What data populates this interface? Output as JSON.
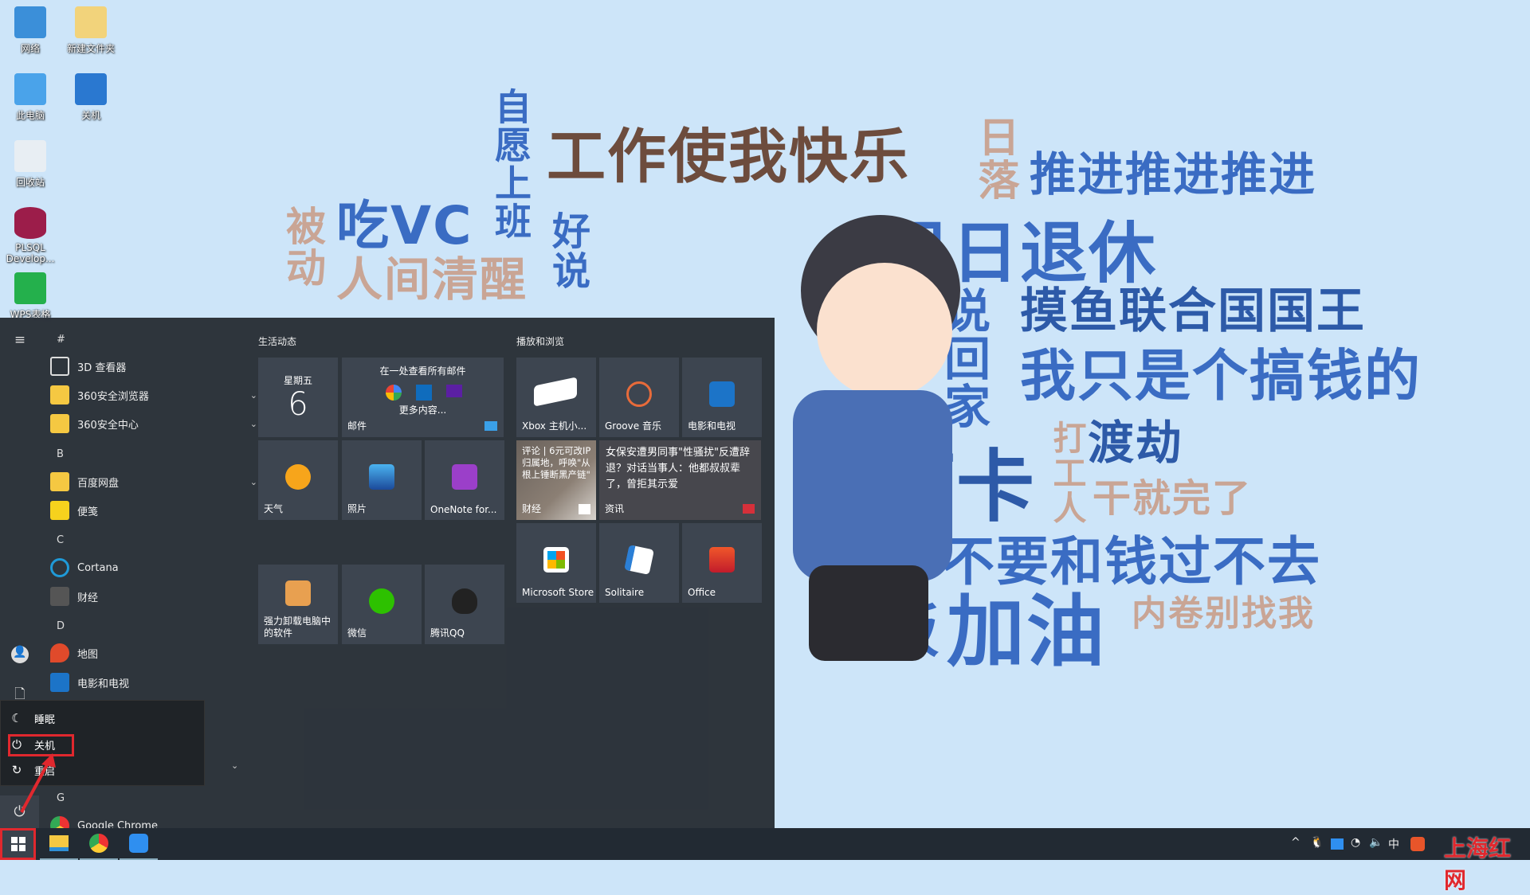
{
  "desktop": {
    "icons": [
      {
        "label": "网络",
        "color": "#3b8fd9"
      },
      {
        "label": "新建文件夹",
        "color": "#f2d37b"
      },
      {
        "label": "此电脑",
        "color": "#4aa3ea"
      },
      {
        "label": "关机",
        "color": "#2a78d0"
      },
      {
        "label": "回收站",
        "color": "#e8eef3"
      },
      {
        "label": "PLSQL Develop...",
        "color": "#9c1d4a"
      },
      {
        "label": "WPS表格",
        "color": "#24b04c"
      }
    ]
  },
  "wallpaper": {
    "words": [
      "工作使我快乐",
      "推进推进推进",
      "自愿上班",
      "日落",
      "吃VC",
      "人间清醒",
      "好说",
      "被动",
      "早日退休",
      "摸鱼联合国国王",
      "我只是个搞钱的",
      "说回家",
      "打卡",
      "渡劫",
      "打工人",
      "干就完了",
      "不要和钱过不去",
      "干饭",
      "加油",
      "内卷别找我"
    ]
  },
  "start_menu": {
    "letters": [
      "#",
      "B",
      "C",
      "D",
      "G"
    ],
    "apps": [
      {
        "label": "3D 查看器",
        "icon": "cube-icon",
        "expandable": false
      },
      {
        "label": "360安全浏览器",
        "icon": "folder-icon",
        "expandable": true
      },
      {
        "label": "360安全中心",
        "icon": "folder-icon",
        "expandable": true
      },
      {
        "label": "百度网盘",
        "icon": "folder-icon",
        "expandable": true
      },
      {
        "label": "便笺",
        "icon": "sticky-notes-icon",
        "expandable": false
      },
      {
        "label": "Cortana",
        "icon": "cortana-icon",
        "expandable": false
      },
      {
        "label": "财经",
        "icon": "finance-icon",
        "expandable": false
      },
      {
        "label": "地图",
        "icon": "maps-icon",
        "expandable": false
      },
      {
        "label": "电影和电视",
        "icon": "movies-icon",
        "expandable": false
      },
      {
        "label": "Google Chrome",
        "icon": "chrome-icon",
        "expandable": false
      }
    ],
    "power_menu": [
      {
        "label": "睡眠",
        "icon": "moon-icon"
      },
      {
        "label": "关机",
        "icon": "power-icon"
      },
      {
        "label": "重启",
        "icon": "restart-icon"
      }
    ],
    "groups": [
      {
        "title": "生活动态",
        "tiles": {
          "calendar": {
            "day": "星期五",
            "date": "6"
          },
          "mail": {
            "headline": "在一处查看所有邮件",
            "more": "更多内容...",
            "label": "邮件"
          },
          "weather": {
            "label": "天气"
          },
          "photos": {
            "label": "照片"
          },
          "onenote": {
            "label": "OneNote for..."
          },
          "uninstall": {
            "label": "强力卸载电脑中的软件"
          },
          "wechat": {
            "label": "微信"
          },
          "qq": {
            "label": "腾讯QQ"
          }
        }
      },
      {
        "title": "播放和浏览",
        "tiles": {
          "xbox": {
            "label": "Xbox 主机小..."
          },
          "groove": {
            "label": "Groove 音乐"
          },
          "movies": {
            "label": "电影和电视"
          },
          "finance": {
            "label": "财经",
            "headline": "评论 | 6元可改IP归属地，呼唤\"从根上锤断黑产链\""
          },
          "news": {
            "label": "资讯",
            "headline": "女保安遭男同事\"性骚扰\"反遭辞退？对话当事人：他都叔叔辈了，曾拒其示爱"
          },
          "store": {
            "label": "Microsoft Store"
          },
          "solitaire": {
            "label": "Solitaire"
          },
          "office": {
            "label": "Office"
          }
        }
      }
    ]
  },
  "taskbar": {
    "tray": {
      "ime": "中"
    }
  },
  "watermark": "上海红网",
  "colors": {
    "highlight": "#e0282e",
    "desktop_bg": "#cde5f9"
  }
}
